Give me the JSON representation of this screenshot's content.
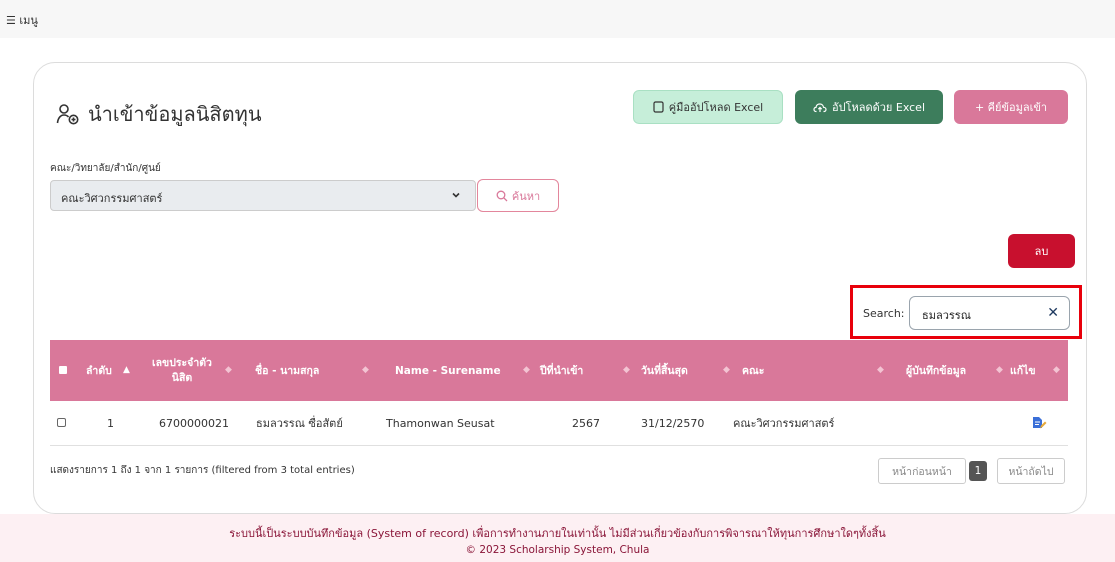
{
  "topbar": {
    "menu_label": "☰ เมนู"
  },
  "page": {
    "title": "นำเข้าข้อมูลนิสิตทุน"
  },
  "actions": {
    "manual_label": "คู่มืออัปโหลด Excel",
    "upload_label": "อัปโหลดด้วย Excel",
    "key_label": "+ คีย์ข้อมูลเข้า",
    "delete_label": "ลบ"
  },
  "filter": {
    "label": "คณะ/วิทยาลัย/สำนัก/ศูนย์",
    "selected": "คณะวิศวกรรมศาสตร์",
    "search_button": "ค้นหา"
  },
  "table_search": {
    "label": "Search:",
    "value": "ธมลวรรณ"
  },
  "table": {
    "headers": [
      "ลำดับ",
      "เลขประจำตัวนิสิต",
      "ชื่อ - นามสกุล",
      "Name - Surename",
      "ปีที่นำเข้า",
      "วันที่สิ้นสุด",
      "คณะ",
      "ผู้บันทึกข้อมูล",
      "แก้ไข"
    ],
    "rows": [
      [
        "1",
        "6700000021",
        "ธมลวรรณ ซื่อสัตย์",
        "Thamonwan Seusat",
        "2567",
        "31/12/2570",
        "คณะวิศวกรรมศาสตร์",
        ""
      ]
    ]
  },
  "pagination": {
    "info": "แสดงรายการ 1 ถึง 1 จาก 1 รายการ (filtered from 3 total entries)",
    "prev": "หน้าก่อนหน้า",
    "current": "1",
    "next": "หน้าถัดไป"
  },
  "footer": {
    "notice": "ระบบนี้เป็นระบบบันทึกข้อมูล (System of record) เพื่อการทำงานภายในเท่านั้น ไม่มีส่วนเกี่ยวข้องกับการพิจารณาให้ทุนการศึกษาใดๆทั้งสิ้น",
    "copyright": "© 2023 Scholarship System, Chula"
  },
  "colors": {
    "pink": "#d9789a",
    "green_dark": "#3d7d5c",
    "green_light": "#c6eed9",
    "red": "#c8102e",
    "highlight": "#e8000b"
  }
}
